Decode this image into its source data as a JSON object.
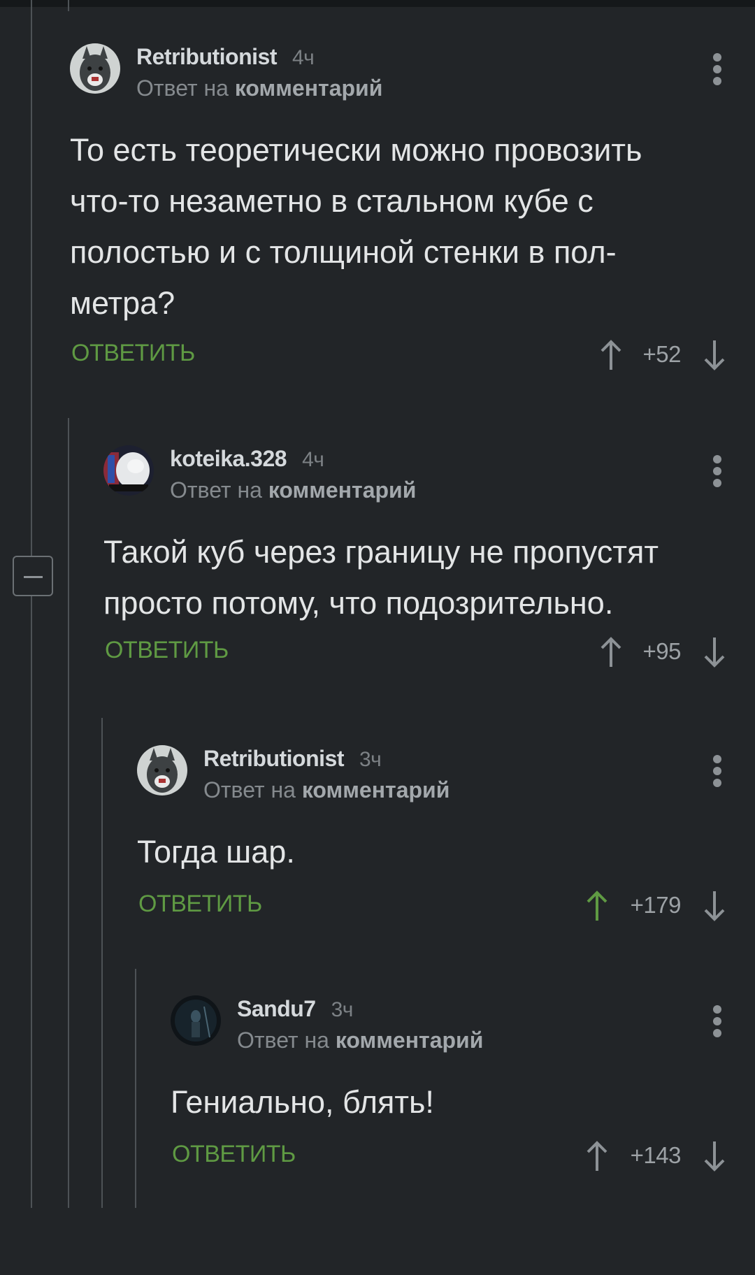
{
  "comments": [
    {
      "author": "Retributionist",
      "time": "4ч",
      "reply_prefix": "Ответ на",
      "reply_target": "комментарий",
      "text": "То есть теоретически можно провозить что-то незаметно в стальном кубе с полостью и с толщиной стенки в пол-метра?",
      "reply_label": "ОТВЕТИТЬ",
      "score": "+52",
      "upvoted": false
    },
    {
      "author": "koteika.328",
      "time": "4ч",
      "reply_prefix": "Ответ на",
      "reply_target": "комментарий",
      "text": "Такой куб через границу не пропустят просто потому, что подозрительно.",
      "reply_label": "ОТВЕТИТЬ",
      "score": "+95",
      "upvoted": false
    },
    {
      "author": "Retributionist",
      "time": "3ч",
      "reply_prefix": "Ответ на",
      "reply_target": "комментарий",
      "text": "Тогда шар.",
      "reply_label": "ОТВЕТИТЬ",
      "score": "+179",
      "upvoted": true
    },
    {
      "author": "Sandu7",
      "time": "3ч",
      "reply_prefix": "Ответ на",
      "reply_target": "комментарий",
      "text": "Гениально, блять!",
      "reply_label": "ОТВЕТИТЬ",
      "score": "+143",
      "upvoted": false
    }
  ],
  "colors": {
    "background": "#222528",
    "reply_action": "#5f9a43",
    "upvote_active": "#5f9a43",
    "vote_inactive": "#9da2a6"
  },
  "icons": {
    "vote_up": "arrow-up-icon",
    "vote_down": "arrow-down-icon",
    "menu": "more-vertical-icon",
    "collapse": "minus-icon"
  }
}
